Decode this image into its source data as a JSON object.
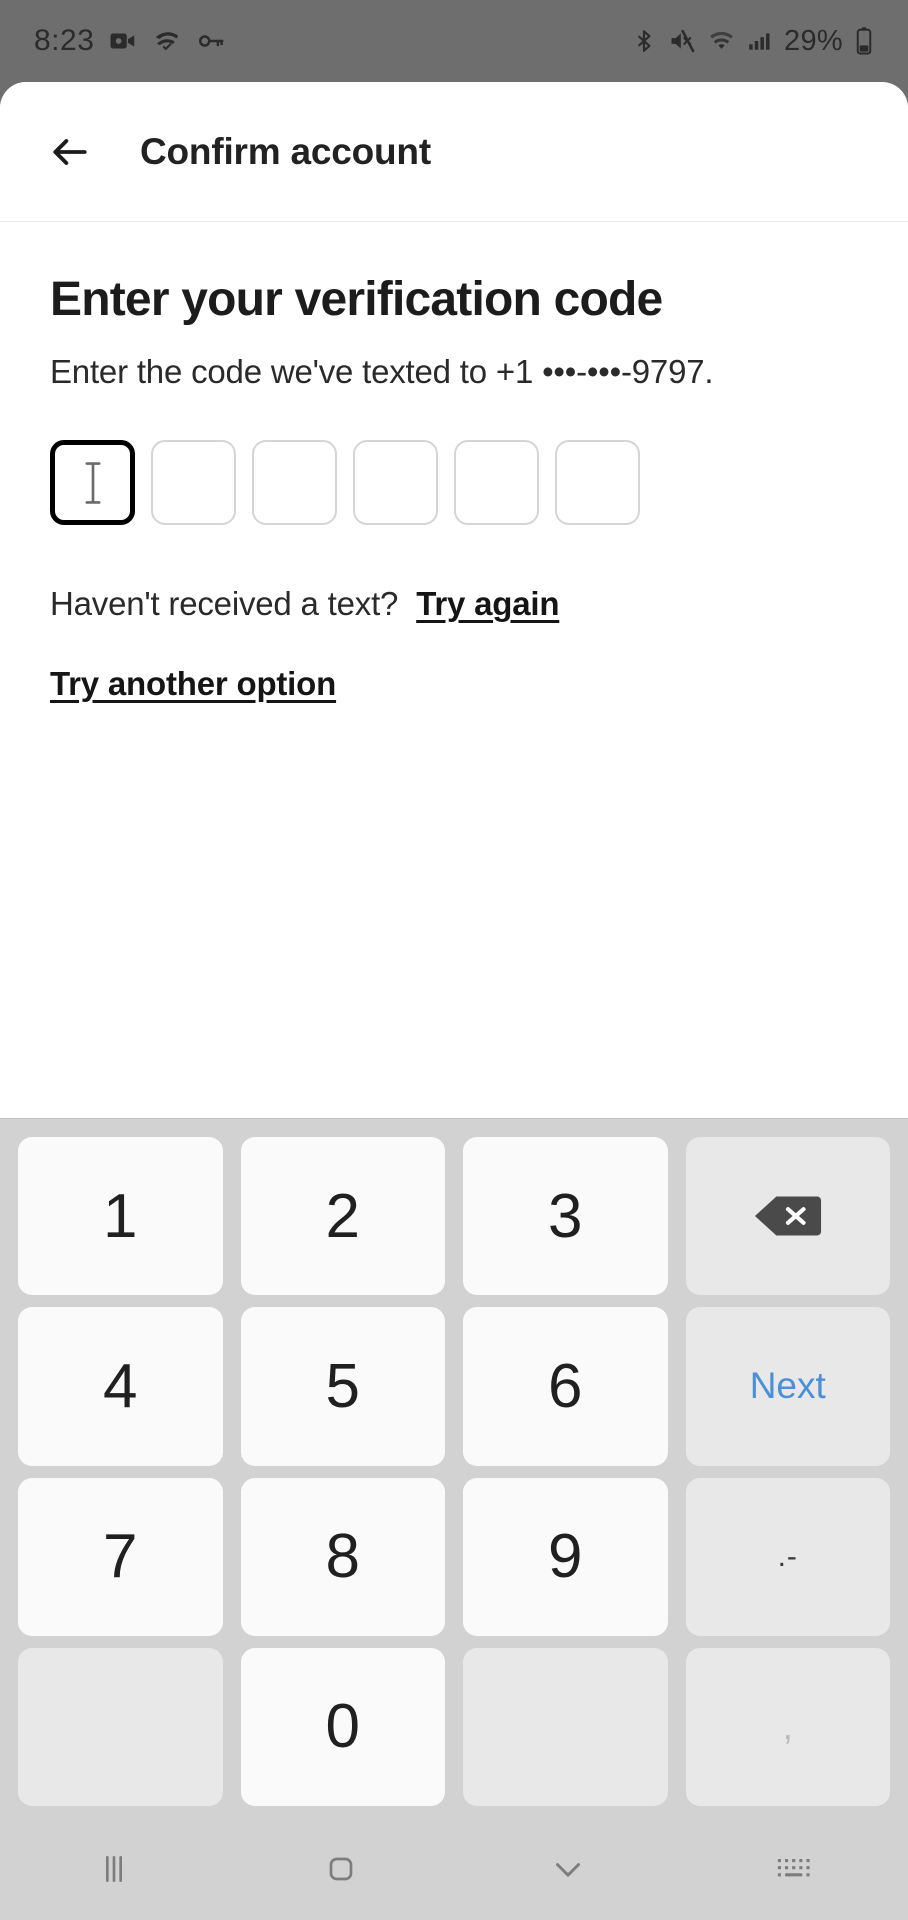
{
  "statusbar": {
    "time": "8:23",
    "battery_percent": "29%",
    "left_icons": [
      "video-camera-icon",
      "vpn-check-icon",
      "key-icon"
    ],
    "right_icons": [
      "bluetooth-icon",
      "mute-icon",
      "wifi-icon",
      "cellular-signal-icon",
      "battery-icon"
    ]
  },
  "appbar": {
    "back_label": "back-arrow",
    "title": "Confirm account"
  },
  "main": {
    "heading": "Enter your verification code",
    "subtitle": "Enter the code we've texted to +1 •••-•••-9797.",
    "code_boxes": [
      {
        "value": "",
        "focused": true
      },
      {
        "value": "",
        "focused": false
      },
      {
        "value": "",
        "focused": false
      },
      {
        "value": "",
        "focused": false
      },
      {
        "value": "",
        "focused": false
      },
      {
        "value": "",
        "focused": false
      }
    ],
    "retry_prompt": "Haven't received a text?",
    "retry_link": "Try again",
    "alt_option_link": "Try another option"
  },
  "keyboard": {
    "rows": [
      [
        {
          "label": "1",
          "type": "num",
          "name": "key-1"
        },
        {
          "label": "2",
          "type": "num",
          "name": "key-2"
        },
        {
          "label": "3",
          "type": "num",
          "name": "key-3"
        },
        {
          "label": "",
          "type": "backspace",
          "name": "backspace-key"
        }
      ],
      [
        {
          "label": "4",
          "type": "num",
          "name": "key-4"
        },
        {
          "label": "5",
          "type": "num",
          "name": "key-5"
        },
        {
          "label": "6",
          "type": "num",
          "name": "key-6"
        },
        {
          "label": "Next",
          "type": "next",
          "name": "next-key"
        }
      ],
      [
        {
          "label": "7",
          "type": "num",
          "name": "key-7"
        },
        {
          "label": "8",
          "type": "num",
          "name": "key-8"
        },
        {
          "label": "9",
          "type": "num",
          "name": "key-9"
        },
        {
          "label": ".-",
          "type": "punct",
          "name": "punctuation-key"
        }
      ],
      [
        {
          "label": "",
          "type": "blank",
          "name": "blank-key-left"
        },
        {
          "label": "0",
          "type": "num",
          "name": "key-0"
        },
        {
          "label": "",
          "type": "blank",
          "name": "blank-key-right"
        },
        {
          "label": ",",
          "type": "comma",
          "name": "comma-key"
        }
      ]
    ],
    "next_color": "#4a90d9"
  },
  "navbar": {
    "items": [
      {
        "name": "recents-icon"
      },
      {
        "name": "home-icon"
      },
      {
        "name": "hide-keyboard-icon"
      },
      {
        "name": "switch-keyboard-icon"
      }
    ]
  }
}
